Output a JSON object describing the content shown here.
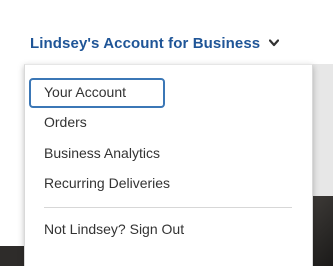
{
  "account_menu": {
    "header_label": "Lindsey's Account for Business",
    "chevron_icon": "chevron-down-icon",
    "items": [
      {
        "label": "Your Account"
      },
      {
        "label": "Orders"
      },
      {
        "label": "Business Analytics"
      },
      {
        "label": "Recurring Deliveries"
      }
    ],
    "signout_label": "Not Lindsey? Sign Out"
  },
  "colors": {
    "header_link": "#1f5597",
    "focus_outline": "#3b77b6",
    "menu_text": "#333333"
  }
}
